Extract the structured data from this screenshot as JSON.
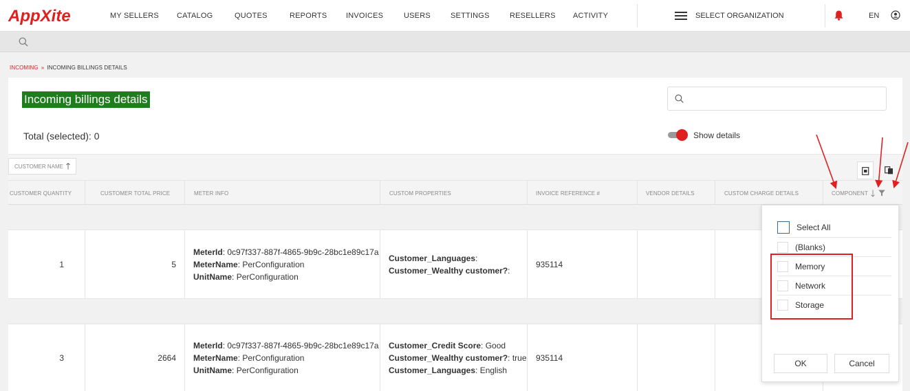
{
  "nav": {
    "items": [
      "MY SELLERS",
      "CATALOG",
      "QUOTES",
      "REPORTS",
      "INVOICES",
      "USERS",
      "SETTINGS",
      "RESELLERS",
      "ACTIVITY"
    ],
    "org_label": "SELECT ORGANIZATION",
    "lang": "EN",
    "icons": [
      "bars-icon",
      "bell-icon",
      "user-circle-icon"
    ],
    "accent_color": "#e02020"
  },
  "breadcrumb": {
    "link": "INCOMING",
    "separator": "»",
    "current": "INCOMING BILLINGS DETAILS"
  },
  "page": {
    "title": "Incoming billings details",
    "title_bg": "#1e7e1e",
    "total_label": "Total (selected): 0",
    "search_placeholder": "",
    "show_details_label": "Show details",
    "show_details_on": true
  },
  "grid": {
    "group_chip": "CUSTOMER NAME",
    "columns": [
      "CUSTOMER QUANTITY",
      "CUSTOMER TOTAL PRICE",
      "METER INFO",
      "CUSTOM PROPERTIES",
      "INVOICE REFERENCE #",
      "VENDOR DETAILS",
      "CUSTOM CHARGE DETAILS",
      "COMPONENT"
    ],
    "rows": [
      {
        "quantity": "1",
        "total_price": "5",
        "meter": [
          {
            "k": "MeterId",
            "v": "0c97f337-887f-4865-9b9c-28bc1e89c17a"
          },
          {
            "k": "MeterName",
            "v": "PerConfiguration"
          },
          {
            "k": "UnitName",
            "v": "PerConfiguration"
          }
        ],
        "props": [
          {
            "k": "Customer_Languages",
            "v": ""
          },
          {
            "k": "Customer_Wealthy customer?",
            "v": ""
          }
        ],
        "invoice_ref": "935114"
      },
      {
        "quantity": "3",
        "total_price": "2664",
        "meter": [
          {
            "k": "MeterId",
            "v": "0c97f337-887f-4865-9b9c-28bc1e89c17a"
          },
          {
            "k": "MeterName",
            "v": "PerConfiguration"
          },
          {
            "k": "UnitName",
            "v": "PerConfiguration"
          }
        ],
        "props": [
          {
            "k": "Customer_Credit Score",
            "v": "Good"
          },
          {
            "k": "Customer_Wealthy customer?",
            "v": "true"
          },
          {
            "k": "Customer_Languages",
            "v": "English"
          }
        ],
        "invoice_ref": "935114"
      }
    ]
  },
  "filter": {
    "options": [
      "Select All",
      "(Blanks)",
      "Memory",
      "Network",
      "Storage"
    ],
    "ok_label": "OK",
    "cancel_label": "Cancel"
  }
}
